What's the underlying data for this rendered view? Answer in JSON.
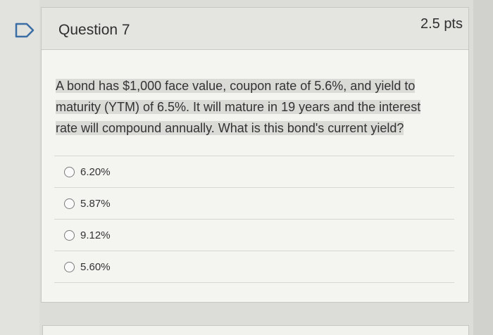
{
  "question": {
    "title": "Question 7",
    "points": "2.5 pts",
    "text_lines": [
      "A bond has $1,000 face value, coupon rate of 5.6%, and yield to",
      "maturity (YTM) of 6.5%. It will mature in 19 years and the interest",
      "rate will compound annually. What is this bond's current yield?"
    ]
  },
  "answers": [
    {
      "label": "6.20%"
    },
    {
      "label": "5.87%"
    },
    {
      "label": "9.12%"
    },
    {
      "label": "5.60%"
    }
  ],
  "colors": {
    "flag": "#3a6ea5",
    "highlight": "#dadad6"
  },
  "icons": {
    "flag": "flag-icon",
    "radio": "radio-icon"
  }
}
